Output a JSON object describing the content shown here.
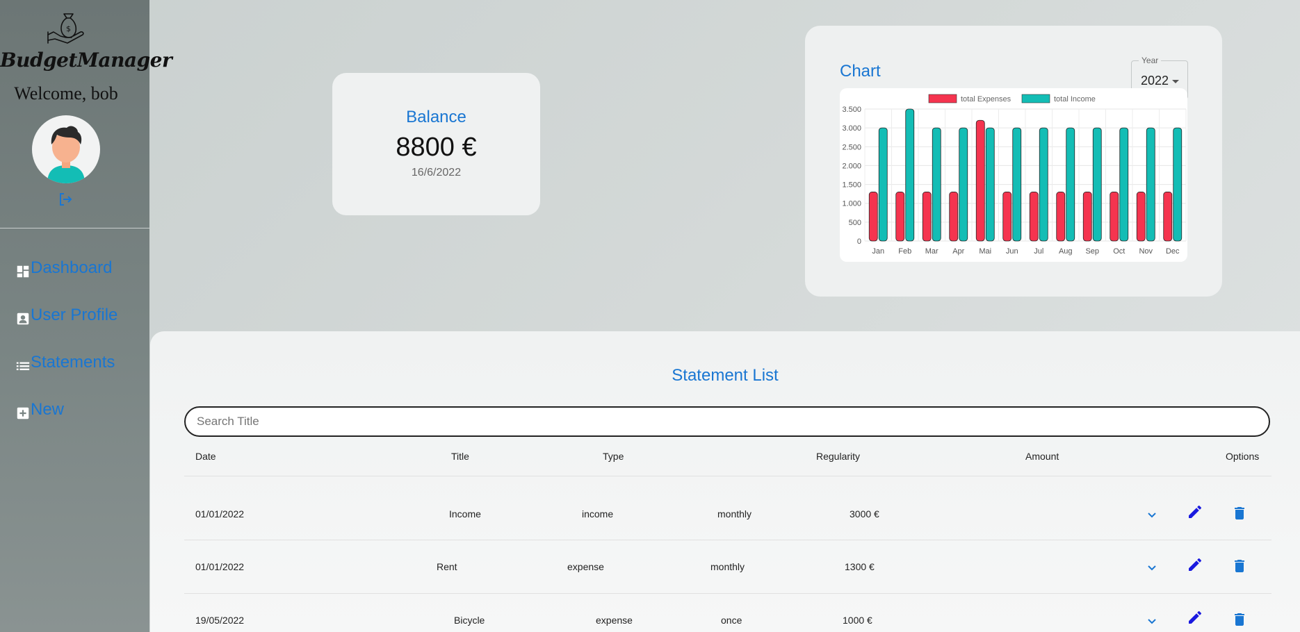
{
  "sidebar": {
    "brand": "BudgetManager",
    "welcome": "Welcome, bob",
    "nav": [
      {
        "label": "Dashboard",
        "icon": "dashboard-icon"
      },
      {
        "label": "User Profile",
        "icon": "account-box-icon"
      },
      {
        "label": "Statements",
        "icon": "list-icon"
      },
      {
        "label": "New",
        "icon": "add-box-icon"
      }
    ]
  },
  "balance": {
    "title": "Balance",
    "value": "8800 €",
    "date": "16/6/2022"
  },
  "chart": {
    "title": "Chart",
    "year_label": "Year",
    "year_value": "2022"
  },
  "chart_data": {
    "type": "bar",
    "categories": [
      "Jan",
      "Feb",
      "Mar",
      "Apr",
      "Mai",
      "Jun",
      "Jul",
      "Aug",
      "Sep",
      "Oct",
      "Nov",
      "Dec"
    ],
    "series": [
      {
        "name": "total Expenses",
        "color": "#f5344f",
        "values": [
          1300,
          1300,
          1300,
          1300,
          3200,
          1300,
          1300,
          1300,
          1300,
          1300,
          1300,
          1300
        ]
      },
      {
        "name": "total Income",
        "color": "#13bdb5",
        "values": [
          3000,
          3500,
          3000,
          3000,
          3000,
          3000,
          3000,
          3000,
          3000,
          3000,
          3000,
          3000
        ]
      }
    ],
    "yticks": [
      "0",
      "500",
      "1.000",
      "1.500",
      "2.000",
      "2.500",
      "3.000",
      "3.500"
    ],
    "ylim": [
      0,
      3500
    ],
    "legend": "top-center",
    "grid": true
  },
  "statements": {
    "title": "Statement List",
    "search_placeholder": "Search Title",
    "columns": [
      "Date",
      "Title",
      "Type",
      "Regularity",
      "Amount",
      "Options"
    ],
    "rows": [
      {
        "date": "01/01/2022",
        "title": "Income",
        "type": "income",
        "regularity": "monthly",
        "amount": "3000 €"
      },
      {
        "date": "01/01/2022",
        "title": "Rent",
        "type": "expense",
        "regularity": "monthly",
        "amount": "1300 €"
      },
      {
        "date": "19/05/2022",
        "title": "Bicycle",
        "type": "expense",
        "regularity": "once",
        "amount": "1000 €"
      }
    ]
  },
  "colors": {
    "accent": "#1976d2",
    "edit": "#1a1adf",
    "expense": "#f5344f",
    "income": "#13bdb5"
  }
}
